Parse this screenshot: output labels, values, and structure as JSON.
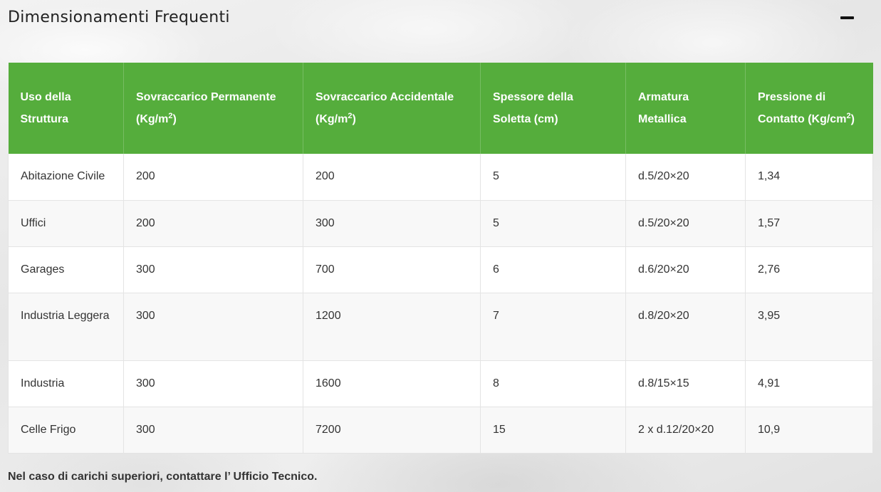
{
  "header": {
    "title": "Dimensionamenti Frequenti",
    "collapse_icon": "minus-icon"
  },
  "table": {
    "columns": [
      {
        "text": "Uso della Struttura",
        "sup": ""
      },
      {
        "text": "Sovraccarico Permanente (Kg/m",
        "sup": "2",
        "after": ")"
      },
      {
        "text": "Sovraccarico Accidentale (Kg/m",
        "sup": "2",
        "after": ")"
      },
      {
        "text": "Spessore della Soletta (cm)",
        "sup": ""
      },
      {
        "text": "Armatura Metallica",
        "sup": ""
      },
      {
        "text": "Pressione di Contatto (Kg/cm",
        "sup": "2",
        "after": ")"
      }
    ],
    "rows": [
      [
        "Abitazione Civile",
        "200",
        "200",
        "5",
        "d.5/20×20",
        "1,34"
      ],
      [
        "Uffici",
        "200",
        "300",
        "5",
        "d.5/20×20",
        "1,57"
      ],
      [
        "Garages",
        "300",
        "700",
        "6",
        "d.6/20×20",
        "2,76"
      ],
      [
        "Industria Leggera",
        "300",
        "1200",
        "7",
        "d.8/20×20",
        "3,95"
      ],
      [
        "Industria",
        "300",
        "1600",
        "8",
        "d.8/15×15",
        "4,91"
      ],
      [
        "Celle Frigo",
        "300",
        "7200",
        "15",
        "2 x d.12/20×20",
        "10,9"
      ]
    ]
  },
  "footnote": "Nel caso di carichi superiori, contattare l’ Ufficio Tecnico.",
  "colors": {
    "header_green": "#55ad3c",
    "row_alt": "#f8f8f8"
  }
}
